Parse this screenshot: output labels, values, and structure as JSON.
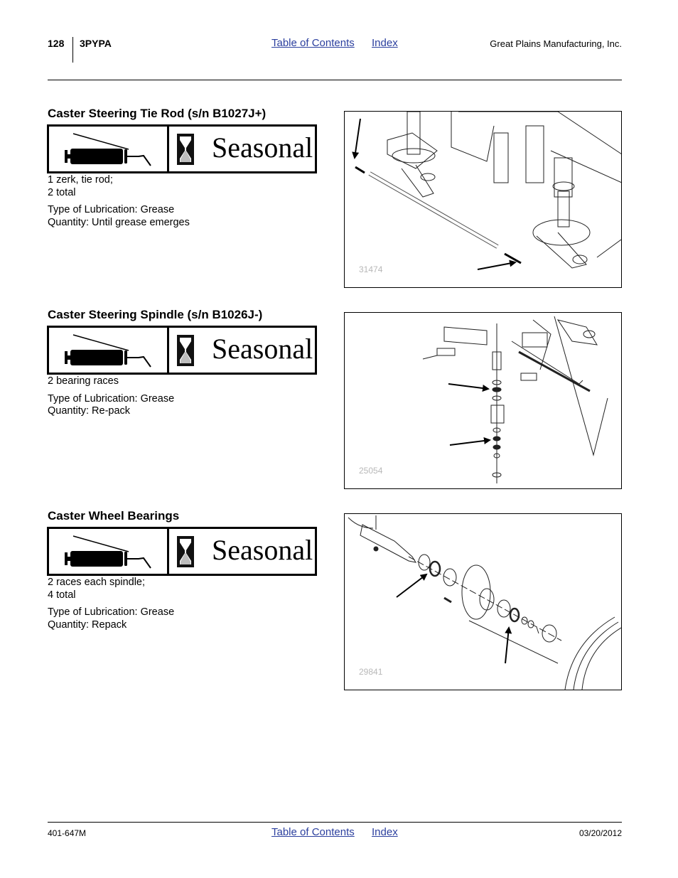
{
  "header": {
    "page_number": "128",
    "model": "3PYPA",
    "links": {
      "toc": "Table of Contents",
      "index": "Index"
    },
    "company": "Great Plains Manufacturing, Inc."
  },
  "footer": {
    "doc_number": "401-647M",
    "links": {
      "toc": "Table of Contents",
      "index": "Index"
    },
    "date": "03/20/2012"
  },
  "colors": {
    "link": "#2b3f9e",
    "figure_number": "#b8b8b8"
  },
  "sections": [
    {
      "title": "Caster Steering Tie Rod (s/n B1027J+)",
      "interval_icon": "hourglass-icon",
      "tool_icon": "grease-gun-icon",
      "interval": "Seasonal",
      "points_line1": "1 zerk, tie rod;",
      "points_line2": "2 total",
      "lube_type": "Type of Lubrication: Grease",
      "quantity": "Quantity: Until grease emerges",
      "figure_number": "31474"
    },
    {
      "title": "Caster Steering Spindle (s/n B1026J-)",
      "interval_icon": "hourglass-icon",
      "tool_icon": "grease-gun-icon",
      "interval": "Seasonal",
      "points_line1": "2 bearing races",
      "lube_type": "Type of Lubrication: Grease",
      "quantity": "Quantity: Re-pack",
      "figure_number": "25054"
    },
    {
      "title": "Caster Wheel Bearings",
      "interval_icon": "hourglass-icon",
      "tool_icon": "grease-gun-icon",
      "interval": "Seasonal",
      "points_line1": "2 races each spindle;",
      "points_line2": "4 total",
      "lube_type": "Type of Lubrication: Grease",
      "quantity": "Quantity: Repack",
      "figure_number": "29841"
    }
  ]
}
